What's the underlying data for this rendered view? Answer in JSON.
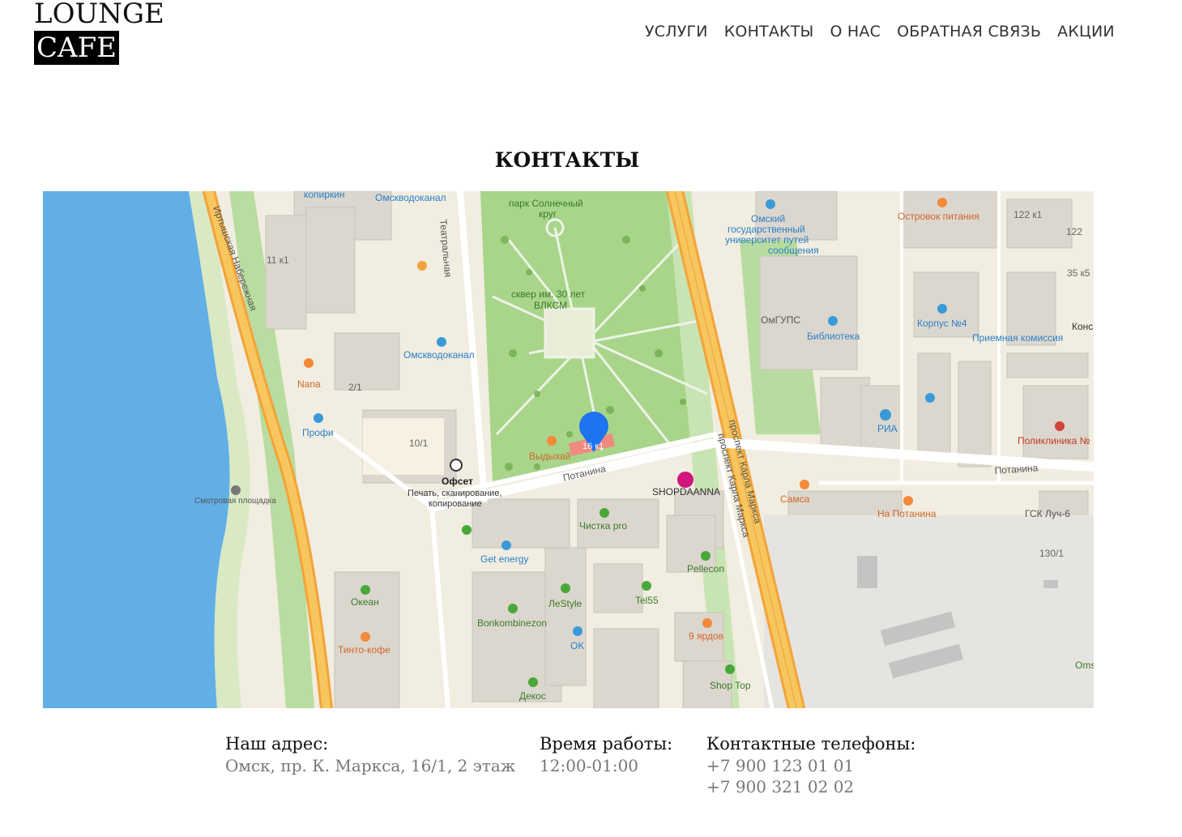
{
  "logo": {
    "line1": "LOUNGE",
    "line2": "CAFE"
  },
  "nav": {
    "items": [
      {
        "label": "УСЛУГИ"
      },
      {
        "label": "КОНТАКТЫ"
      },
      {
        "label": "О НАС"
      },
      {
        "label": "ОБРАТНАЯ СВЯЗЬ"
      },
      {
        "label": "АКЦИИ"
      }
    ]
  },
  "page": {
    "title": "КОНТАКТЫ"
  },
  "map": {
    "labels": {
      "kopirkin": "копиркин",
      "omskvodokanal1": "Омскводоканал",
      "teatralnaya": "Театральная",
      "park": "парк Солнечный",
      "park2": "круг",
      "university1": "Омский",
      "university2": "государственный",
      "university3": "университет путей",
      "university4": "сообщения",
      "ostrovok": "Островок питания",
      "b122k1": "122 к1",
      "b122": "122",
      "b35k5": "35 к5",
      "kons": "Конс",
      "irtysh": "Иртышская Набережная",
      "b11k1": "11 к1",
      "skver1": "сквер им. 30 лет",
      "skver2": "ВЛКСМ",
      "omgups": "ОмГУПС",
      "biblioteka": "Библиотека",
      "korpus4": "Корпус №4",
      "priemnaya": "Приемная комиссия",
      "omskvodokanal2": "Омскводоканал",
      "nana": "Nana",
      "b2_1": "2/1",
      "profi": "Профи",
      "b10_1": "10/1",
      "ria": "РИА",
      "poliklinika": "Поликлиника №",
      "vydyhai": "Выдыхай",
      "pin_label": "16 к1",
      "ofset": "Офсет",
      "ofset_desc1": "Печать, сканирование,",
      "ofset_desc2": "копирование",
      "potanina1": "Потанина",
      "potanina2": "Потанина",
      "prospekt1": "проспект Карла Маркса",
      "prospekt2": "проспект Карла Маркса",
      "shopdaanna": "SHOPDAANNA",
      "samsa": "Самса",
      "napotanina": "На Потанина",
      "gsk": "ГСК Луч-6",
      "b130_1": "130/1",
      "smotrovaya": "Смотровая площадка",
      "chistka": "Чистка pro",
      "getenergy": "Get energy",
      "pellecon": "Pellecon",
      "okean": "Океан",
      "lestyle": "ЛеStyle",
      "tel55": "Tel55",
      "bonkombinezon": "Bonkombinezon",
      "tinto": "Тинто-кофе",
      "ok": "OK",
      "yardov": "9 ярдов",
      "oms": "Oms",
      "shoptop": "Shop Top",
      "dekos": "Декос"
    }
  },
  "contacts": {
    "address_label": "Наш адрес:",
    "address_value": "Омск, пр. К. Маркса, 16/1, 2 этаж",
    "hours_label": "Время работы:",
    "hours_value": "12:00-01:00",
    "phones_label": "Контактные телефоны:",
    "phone1": "+7 900 123 01 01",
    "phone2": "+7 900 321 02 02"
  },
  "colors": {
    "water": "#5aa9e6",
    "road_major": "#f6b13a",
    "park": "#a9d88c",
    "pin": "#1e73f0"
  }
}
